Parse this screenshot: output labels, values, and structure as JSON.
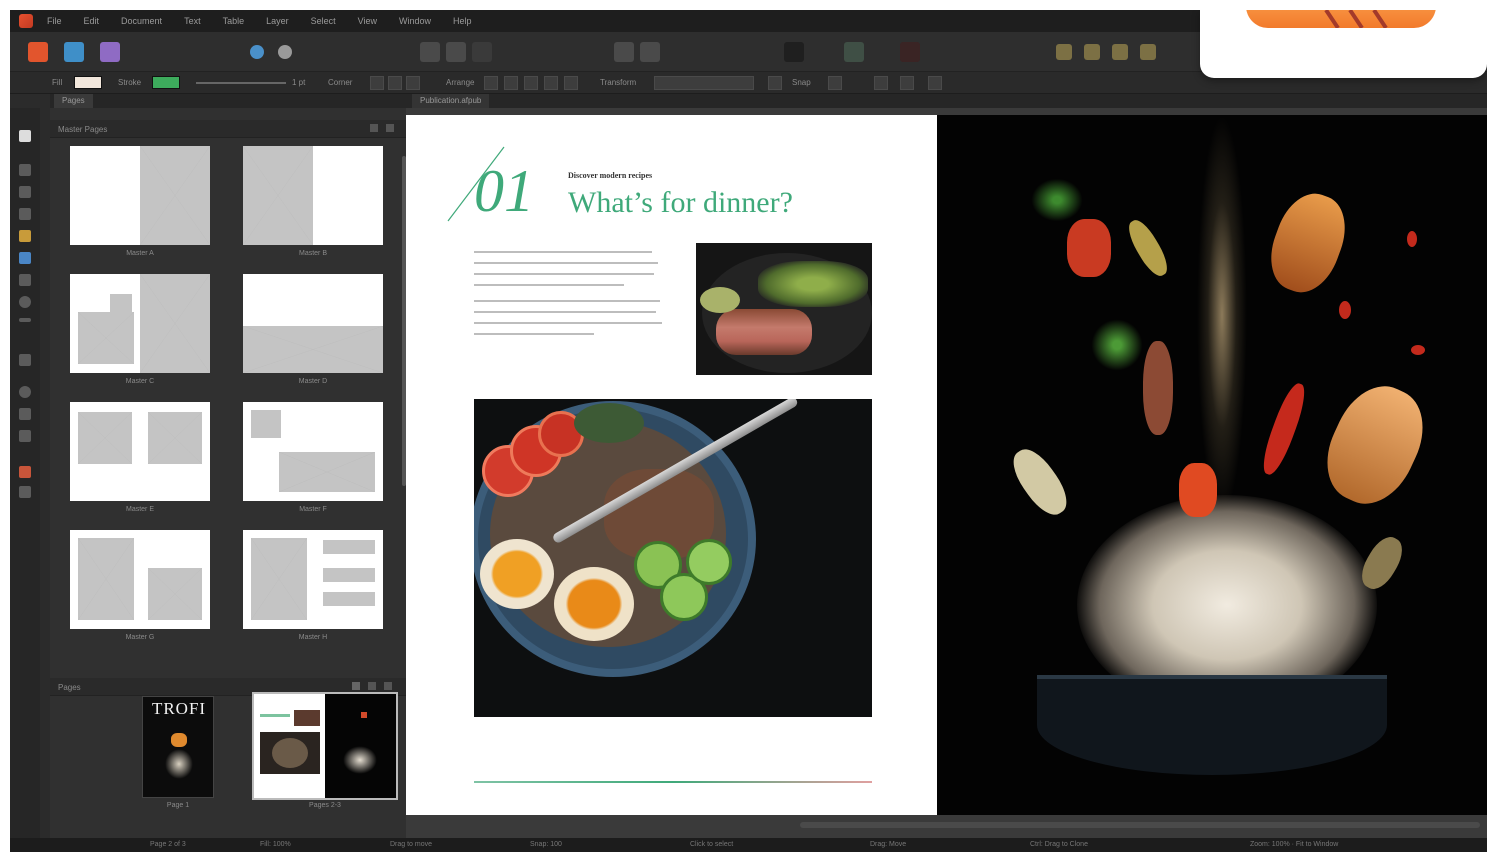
{
  "colors": {
    "accent": "#3fa97a",
    "app_logo": "#e8502f",
    "menubar": "#1e1e1e",
    "panel": "#303030",
    "canvas": "#3a3a3a"
  },
  "menubar": {
    "app_icon": "affinity-publisher-icon",
    "items": [
      "File",
      "Edit",
      "Document",
      "Text",
      "Table",
      "Layer",
      "Select",
      "View",
      "Window",
      "Help"
    ]
  },
  "context_toolbar": {
    "fill_label": "Fill",
    "stroke_label": "Stroke",
    "stroke_width": "1 pt",
    "corner_label": "Corner",
    "arrange_label": "Arrange",
    "transform_label": "Transform",
    "snap_label": "Snap"
  },
  "panel_tab": "Pages",
  "document_tab": "Publication.afpub",
  "master_pages": {
    "header": "Master Pages",
    "items": [
      {
        "label": "Master A"
      },
      {
        "label": "Master B"
      },
      {
        "label": "Master C"
      },
      {
        "label": "Master D"
      },
      {
        "label": "Master E"
      },
      {
        "label": "Master F"
      },
      {
        "label": "Master G"
      },
      {
        "label": "Master H"
      }
    ]
  },
  "pages": {
    "header": "Pages",
    "cover_title": "TROFI",
    "thumbs": [
      {
        "label": "Page 1"
      },
      {
        "label": "Pages 2-3"
      }
    ]
  },
  "spread": {
    "number": "01",
    "kicker": "Discover modern recipes",
    "headline": "What’s for dinner?"
  },
  "statusbar": {
    "items": [
      "Page 2 of 3",
      "Fill: 100%",
      "Drag to move",
      "Snap: 100",
      "Click to select",
      "Drag: Move",
      "Ctrl: Drag to Clone",
      "Zoom: 100% · Fit to Window"
    ]
  }
}
